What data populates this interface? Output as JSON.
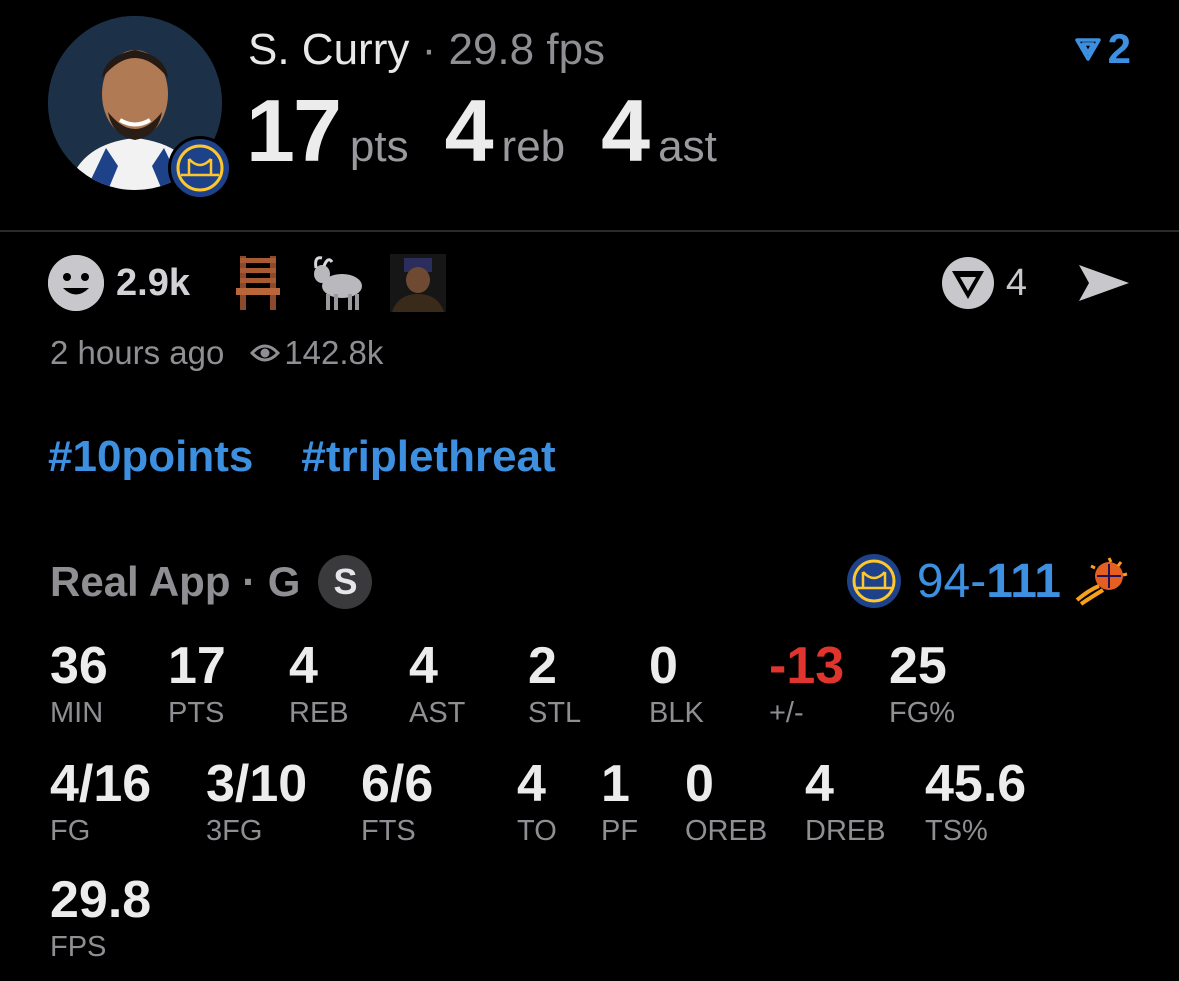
{
  "player": {
    "name": "S. Curry",
    "separator": "·",
    "fps_label": "29.8 fps",
    "headline": [
      {
        "value": "17",
        "unit": "pts"
      },
      {
        "value": "4",
        "unit": "reb"
      },
      {
        "value": "4",
        "unit": "ast"
      }
    ]
  },
  "top_vote": {
    "count": "2",
    "icon": "vote-filter-icon"
  },
  "reactions": {
    "count": "2.9k",
    "icons": [
      "smiley-icon",
      "chair-emoji",
      "goat-emoji",
      "player-thumbnail"
    ]
  },
  "vote_action": {
    "count": "4",
    "icon": "vote-icon",
    "share_icon": "share-icon"
  },
  "meta": {
    "time_ago": "2 hours ago",
    "views": "142.8k"
  },
  "hashtags": [
    "#10points",
    "#triplethreat"
  ],
  "game": {
    "source_label": "Real App · G",
    "position_badge": "S",
    "score_home": "94-",
    "score_away": "111"
  },
  "stats_row1": [
    {
      "value": "36",
      "label": "MIN"
    },
    {
      "value": "17",
      "label": "PTS"
    },
    {
      "value": "4",
      "label": "REB"
    },
    {
      "value": "4",
      "label": "AST"
    },
    {
      "value": "2",
      "label": "STL"
    },
    {
      "value": "0",
      "label": "BLK"
    },
    {
      "value": "-13",
      "label": "+/-"
    },
    {
      "value": "25",
      "label": "FG%"
    }
  ],
  "stats_row2": [
    {
      "value": "4/16",
      "label": "FG"
    },
    {
      "value": "3/10",
      "label": "3FG"
    },
    {
      "value": "6/6",
      "label": "FTS"
    },
    {
      "value": "4",
      "label": "TO"
    },
    {
      "value": "1",
      "label": "PF"
    },
    {
      "value": "0",
      "label": "OREB"
    },
    {
      "value": "4",
      "label": "DREB"
    },
    {
      "value": "45.6",
      "label": "TS%"
    }
  ],
  "stats_row3": [
    {
      "value": "29.8",
      "label": "FPS"
    }
  ],
  "colors": {
    "accent": "#3d8fe0",
    "negative": "#e0342f",
    "muted": "#8e8e93",
    "background": "#000000"
  }
}
